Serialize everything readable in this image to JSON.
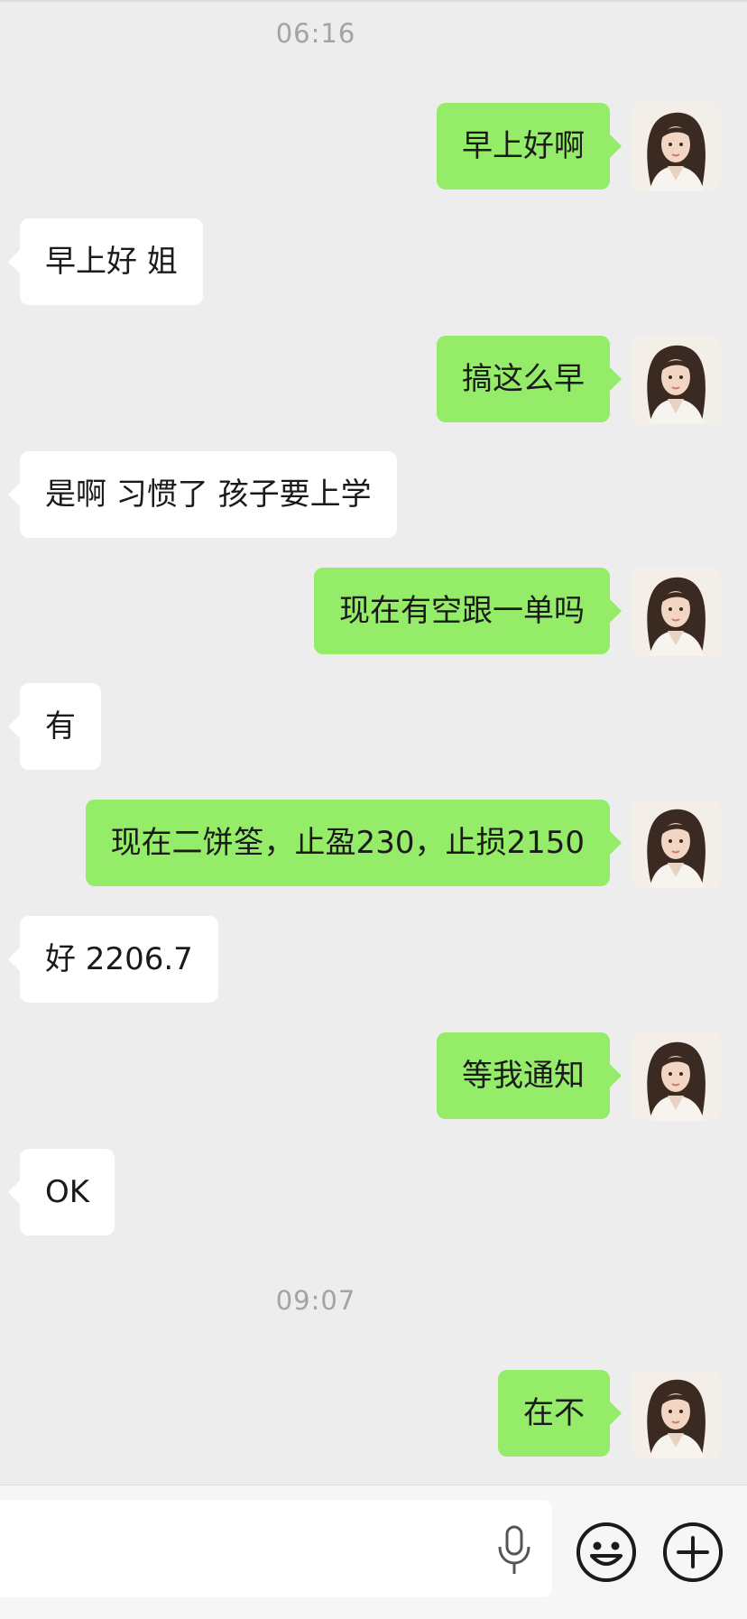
{
  "chat": {
    "timestamp_1": "06:16",
    "timestamp_2": "09:07",
    "messages": [
      {
        "side": "out",
        "text": "早上好啊"
      },
      {
        "side": "in",
        "text": "早上好 姐"
      },
      {
        "side": "out",
        "text": "搞这么早"
      },
      {
        "side": "in",
        "text": "是啊 习惯了 孩子要上学"
      },
      {
        "side": "out",
        "text": "现在有空跟一单吗"
      },
      {
        "side": "in",
        "text": "有"
      },
      {
        "side": "out",
        "text": "现在二饼筌，止盈230，止损2150"
      },
      {
        "side": "in",
        "text": "好 2206.7"
      },
      {
        "side": "out",
        "text": "等我通知"
      },
      {
        "side": "in",
        "text": "OK"
      },
      {
        "side": "out",
        "text": "在不"
      }
    ]
  },
  "input_bar": {
    "icons": [
      "microphone-icon",
      "emoji-icon",
      "plus-icon"
    ]
  },
  "colors": {
    "background": "#ededed",
    "outgoing_bubble": "#95ec69",
    "incoming_bubble": "#ffffff",
    "timestamp_text": "#a3a3a3"
  }
}
